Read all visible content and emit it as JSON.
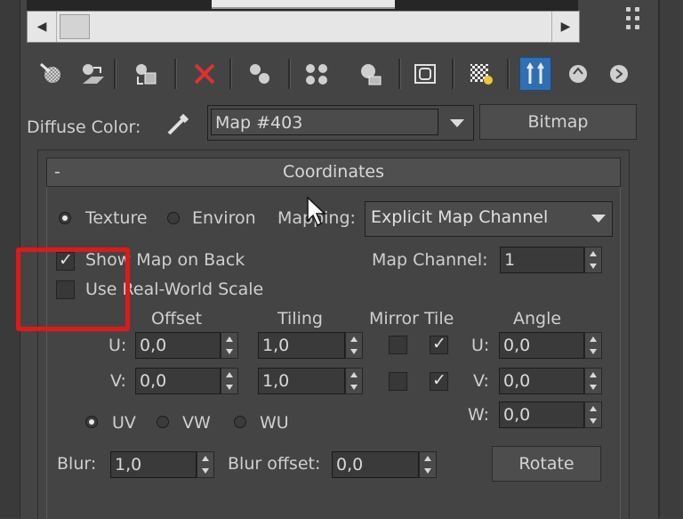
{
  "toolbar": {
    "icons": [
      "get-material-icon",
      "put-to-scene-icon",
      "assign-to-selection-icon",
      "delete-icon",
      "make-copy-icon",
      "make-unique-icon",
      "put-to-library-icon",
      "material-id-channel-icon",
      "show-map-icon",
      "show-end-result-icon",
      "go-to-parent-icon",
      "go-forward-icon"
    ],
    "active_icon": "go-to-parent-icon",
    "delete_color": "#e03030"
  },
  "diffuse": {
    "label": "Diffuse Color:",
    "map_name": "Map #403",
    "map_type_button": "Bitmap"
  },
  "coordinates": {
    "title": "Coordinates",
    "collapse_symbol": "-",
    "texture_label": "Texture",
    "environ_label": "Environ",
    "selected_mode": "Texture",
    "mapping_label": "Mapping:",
    "mapping_value": "Explicit Map Channel",
    "show_map_on_back_label": "Show Map on Back",
    "show_map_on_back": true,
    "use_real_world_scale_label": "Use Real-World Scale",
    "use_real_world_scale": false,
    "map_channel_label": "Map Channel:",
    "map_channel_value": "1",
    "headers": {
      "offset": "Offset",
      "tiling": "Tiling",
      "mirror_tile": "Mirror Tile",
      "angle": "Angle"
    },
    "u_label": "U:",
    "v_label": "V:",
    "w_label": "W:",
    "offset_u": "0,0",
    "offset_v": "0,0",
    "tiling_u": "1,0",
    "tiling_v": "1,0",
    "mirror_u": false,
    "tile_u": true,
    "mirror_v": false,
    "tile_v": true,
    "angle_u": "0,0",
    "angle_v": "0,0",
    "angle_w": "0,0",
    "uv_label": "UV",
    "vw_label": "VW",
    "wu_label": "WU",
    "selected_plane": "UV",
    "blur_label": "Blur:",
    "blur_value": "1,0",
    "blur_offset_label": "Blur offset:",
    "blur_offset_value": "0,0",
    "rotate_button": "Rotate"
  },
  "highlight_color": "#e01818"
}
